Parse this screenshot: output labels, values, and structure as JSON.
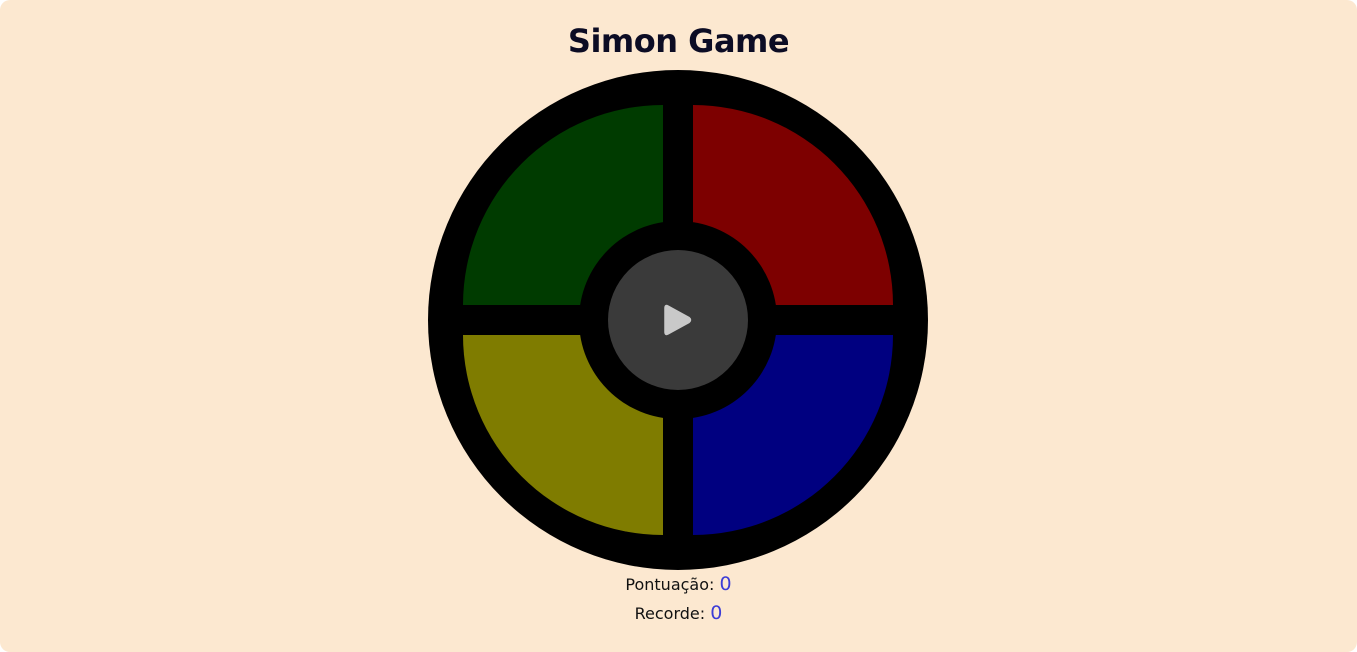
{
  "title": "Simon Game",
  "colors": {
    "background": "#fce8d0",
    "green": "#003b00",
    "red": "#7d0000",
    "yellow": "#7f7c00",
    "blue": "#000080",
    "board": "#000000",
    "start_button": "#3a3a3a",
    "play_icon": "#c9c9c9",
    "score_value": "#3d3dd6"
  },
  "start_button": {
    "icon": "play-icon"
  },
  "score": {
    "label": "Pontuação:",
    "value": "0"
  },
  "record": {
    "label": "Recorde:",
    "value": "0"
  }
}
